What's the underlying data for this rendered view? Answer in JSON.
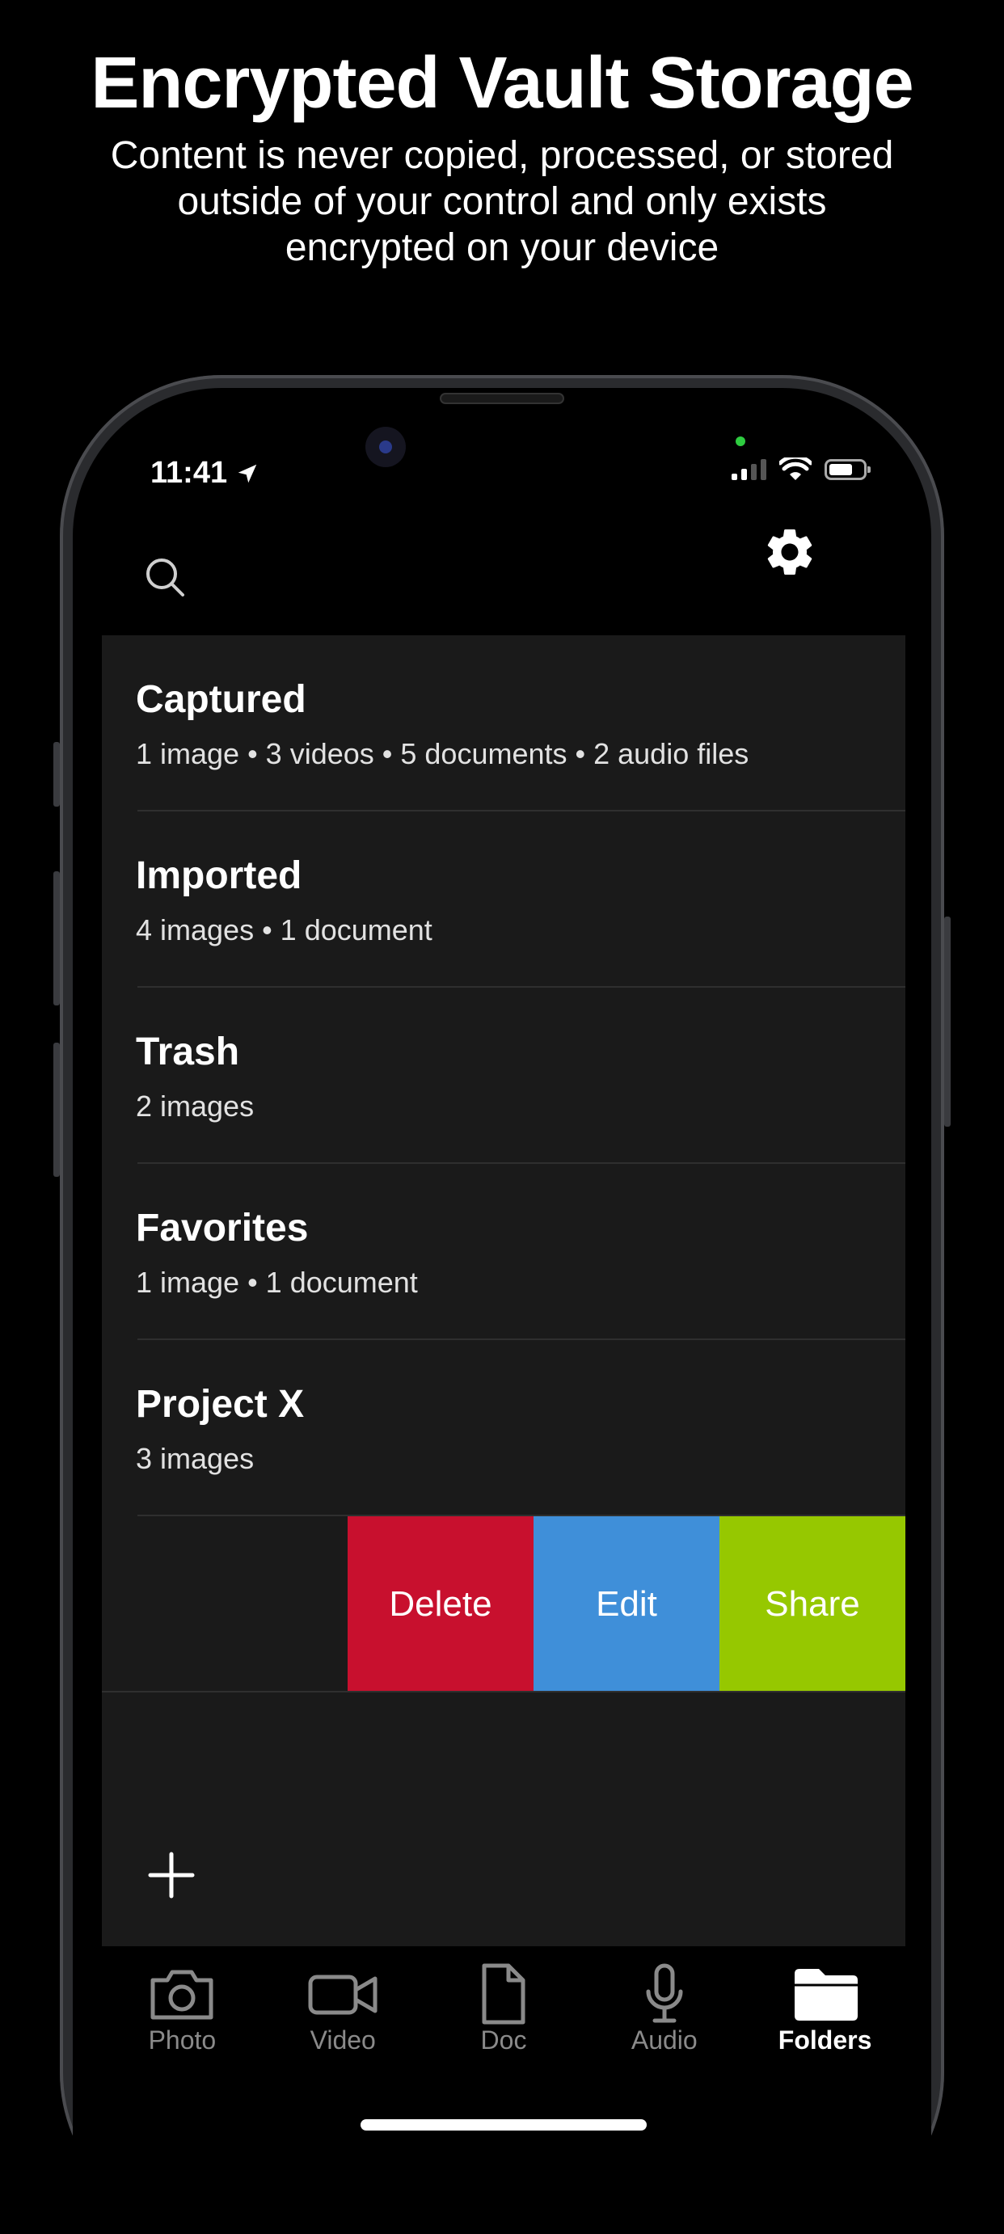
{
  "promo": {
    "headline": "Encrypted Vault Storage",
    "subline": "Content is never copied, processed, or stored outside of your control and only exists encrypted on your device"
  },
  "status_bar": {
    "time": "11:41"
  },
  "folders": [
    {
      "title": "Captured",
      "meta": "1 image • 3 videos • 5 documents • 2 audio files"
    },
    {
      "title": "Imported",
      "meta": "4 images • 1 document"
    },
    {
      "title": "Trash",
      "meta": "2 images"
    },
    {
      "title": "Favorites",
      "meta": "1 image • 1 document"
    },
    {
      "title": "Project X",
      "meta": "3 images"
    }
  ],
  "swipe_actions": {
    "delete": {
      "label": "Delete",
      "color": "#c8102e"
    },
    "edit": {
      "label": "Edit",
      "color": "#3f8fd9"
    },
    "share": {
      "label": "Share",
      "color": "#96c800"
    }
  },
  "tabs": [
    {
      "label": "Photo",
      "icon": "camera-icon"
    },
    {
      "label": "Video",
      "icon": "video-icon"
    },
    {
      "label": "Doc",
      "icon": "document-icon"
    },
    {
      "label": "Audio",
      "icon": "microphone-icon"
    },
    {
      "label": "Folders",
      "icon": "folder-icon",
      "active": true
    }
  ],
  "colors": {
    "background": "#000000",
    "list_background": "#1a1a1a",
    "inactive_tab": "#8a8a8a"
  }
}
